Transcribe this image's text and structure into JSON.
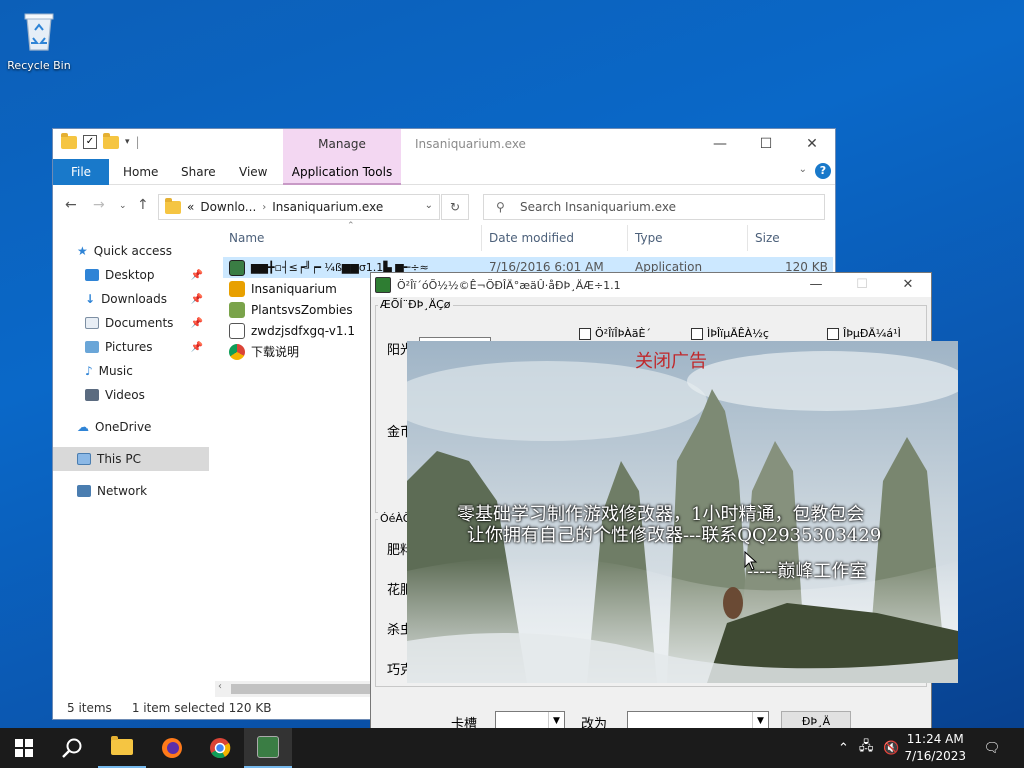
{
  "desktop": {
    "recycle_bin_label": "Recycle Bin"
  },
  "explorer": {
    "manage_tab": "Manage",
    "window_title": "Insaniquarium.exe",
    "ribbon": {
      "file": "File",
      "home": "Home",
      "share": "Share",
      "view": "View",
      "app_tools": "Application Tools"
    },
    "address": {
      "crumb1": "Downlo...",
      "crumb2": "Insaniquarium.exe",
      "prefix": "«"
    },
    "search_placeholder": "Search Insaniquarium.exe",
    "sidebar": {
      "quick_access": "Quick access",
      "desktop": "Desktop",
      "downloads": "Downloads",
      "documents": "Documents",
      "pictures": "Pictures",
      "music": "Music",
      "videos": "Videos",
      "onedrive": "OneDrive",
      "this_pc": "This PC",
      "network": "Network"
    },
    "columns": {
      "name": "Name",
      "date": "Date modified",
      "type": "Type",
      "size": "Size"
    },
    "files": [
      {
        "name": "▆▆╋▫┤≤┍╝┍╸¼ß▆▆σ1.1▙ ▆╾÷≈",
        "date": "7/16/2016 6:01 AM",
        "type": "Application",
        "size": "120 KB"
      },
      {
        "name": "Insaniquarium"
      },
      {
        "name": "PlantsvsZombies"
      },
      {
        "name": "zwdzjsdfxgq-v1.1"
      },
      {
        "name": "下载说明"
      }
    ],
    "status": {
      "items": "5 items",
      "selected": "1 item selected  120 KB"
    }
  },
  "trainer": {
    "title": "Ö²Îï´óÕ½½©Ê¬ÖÐÎÄ°æäÛ·åÐÞ¸ÄÆ÷1.1",
    "group1_label": "ÆÕÍ¨ÐÞ¸ÄÇø",
    "group2_label": "ÓéÀÖ",
    "label_sun": "阳光",
    "label_gold": "金币",
    "label_fert": "肥料",
    "label_flower": "花肥",
    "label_bug": "杀虫",
    "label_choc": "巧克",
    "check1": "Ö²ÎïÎÞÀäÈ´",
    "check2": "ÌÞÎïµÄÊÀ½ç",
    "check3": "ÎÞµÐÄ¼á¹Ì",
    "slot_label": "卡槽",
    "change_label": "改为",
    "modify_button": "ÐÞ¸Ä"
  },
  "ad": {
    "close_text": "关闭广告",
    "line1": "零基础学习制作游戏修改器，1小时精通，包教包会",
    "line2": "让你拥有自己的个性修改器---联系QQ2935303429",
    "signature": "-----巅峰工作室"
  },
  "taskbar": {
    "time": "11:24 AM",
    "date": "7/16/2023"
  },
  "colors": {
    "accent": "#1979ca",
    "ad_close": "#c0282b",
    "manage_tab": "#f3d7f2"
  }
}
